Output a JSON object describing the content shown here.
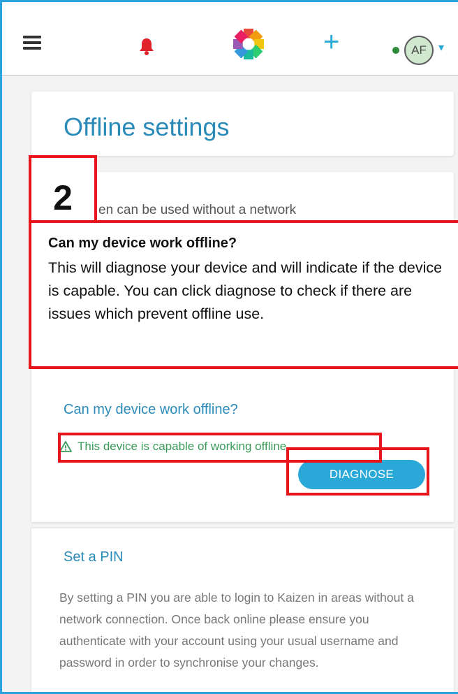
{
  "topbar": {
    "menu_icon": "hamburger-menu-icon",
    "notification_icon": "bell-icon",
    "logo_icon": "app-logo-icon",
    "add_label": "+",
    "avatar_initials": "AF",
    "status_color": "#2e8b3a"
  },
  "page": {
    "title": "Offline settings"
  },
  "intro": {
    "text_fragment": "en can be used without a network"
  },
  "annotation": {
    "step_number": "2",
    "tip_title": "Can my device work offline?",
    "tip_text": "This will diagnose your device and will indicate if the device is capable. You can click diagnose to check if there are issues which prevent offline use.",
    "highlight_color": "#e8151b"
  },
  "device_check": {
    "title": "Can my device work offline?",
    "status_text": "This device is capable of working offline",
    "status_icon": "warning-triangle-icon",
    "diagnose_label": "DIAGNOSE"
  },
  "pin": {
    "title": "Set a PIN",
    "body": "By setting a PIN you are able to login to Kaizen in areas without a network connection. Once back online please ensure you authenticate with your account using your usual username and password in order to synchronise your changes."
  },
  "colors": {
    "accent": "#2aa8d8",
    "title": "#2a8ab8",
    "success": "#3a9a5a"
  }
}
